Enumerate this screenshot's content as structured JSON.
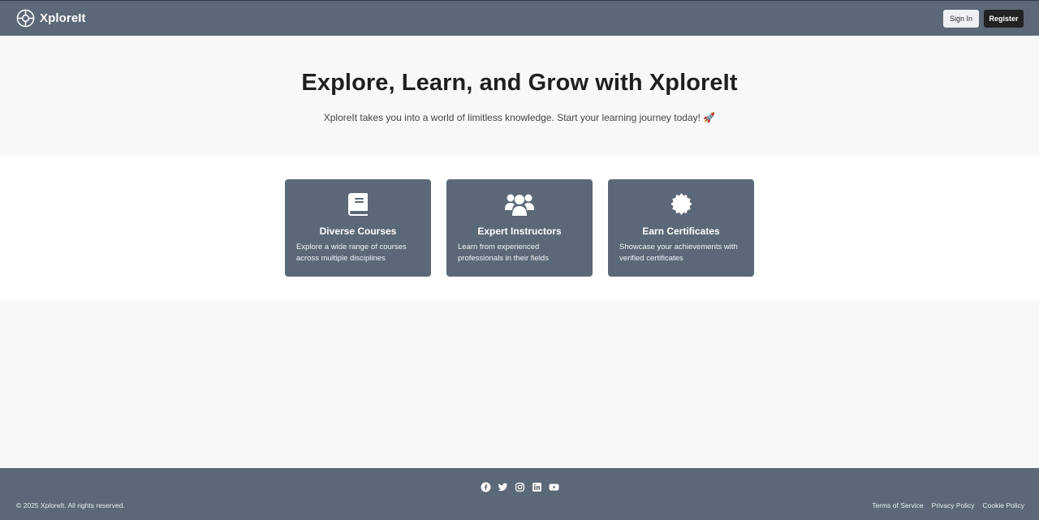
{
  "header": {
    "brand_name": "XploreIt",
    "logo_icon": "crosshair-compass-icon",
    "signin_label": "Sign In",
    "register_label": "Register"
  },
  "hero": {
    "title": "Explore, Learn, and Grow with XploreIt",
    "subtitle": "XploreIt takes you into a world of limitless knowledge. Start your learning journey today!",
    "subtitle_emoji": "🚀"
  },
  "features": [
    {
      "icon": "book-icon",
      "title": "Diverse Courses",
      "description": "Explore a wide range of courses across multiple disciplines"
    },
    {
      "icon": "users-icon",
      "title": "Expert Instructors",
      "description": "Learn from experienced professionals in their fields"
    },
    {
      "icon": "certificate-icon",
      "title": "Earn Certificates",
      "description": "Showcase your achievements with verified certificates"
    }
  ],
  "footer": {
    "socials": [
      "facebook-icon",
      "twitter-icon",
      "instagram-icon",
      "linkedin-icon",
      "youtube-icon"
    ],
    "copyright": "© 2025 XploreIt. All rights reserved.",
    "links": [
      "Terms of Service",
      "Privacy Policy",
      "Cookie Policy"
    ]
  },
  "colors": {
    "primary": "#5b6877",
    "register_button": "#222222",
    "signin_button": "#eef0f3",
    "page_background": "#f8f8f8",
    "features_background": "#ffffff"
  }
}
